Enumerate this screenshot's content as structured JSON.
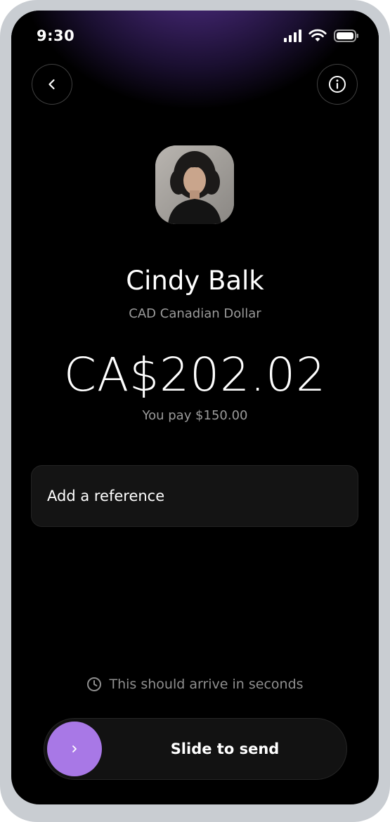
{
  "status_bar": {
    "time": "9:30",
    "icons": [
      "cellular-signal-icon",
      "wifi-icon",
      "battery-icon"
    ]
  },
  "nav": {
    "back_icon": "chevron-left-icon",
    "info_icon": "info-icon"
  },
  "recipient": {
    "name": "Cindy Balk",
    "currency": "CAD Canadian Dollar",
    "avatar": "recipient-avatar"
  },
  "transfer": {
    "amount": "CA$202.02",
    "you_pay": "You pay $150.00"
  },
  "reference": {
    "label": "Add a reference"
  },
  "arrival": {
    "icon": "clock-icon",
    "text": "This should arrive in seconds"
  },
  "slider": {
    "label": "Slide to send",
    "handle_icon": "chevron-right-icon"
  },
  "colors": {
    "background": "#000000",
    "glow": "#5b3596",
    "accent": "#a878e6",
    "text_primary": "#ffffff",
    "text_secondary": "#9b9b9b"
  }
}
